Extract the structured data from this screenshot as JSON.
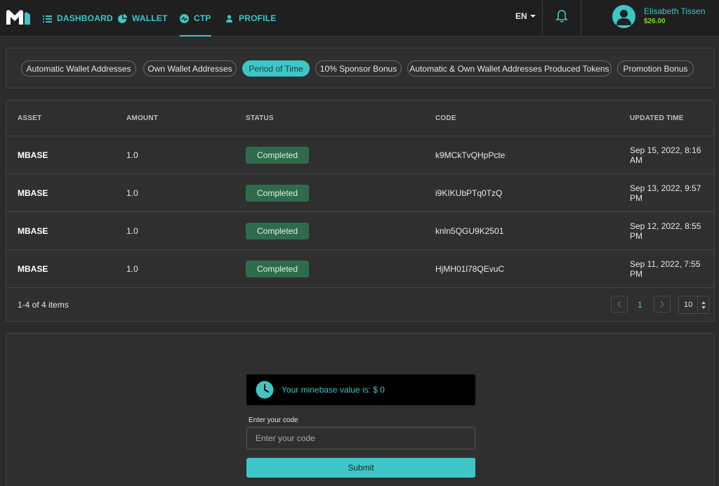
{
  "brand": {
    "logo_icon": "minebase-m-logo",
    "accent": "#3ec6c6"
  },
  "nav": {
    "items": [
      {
        "label": "DASHBOARD",
        "icon": "list-icon"
      },
      {
        "label": "WALLET",
        "icon": "pie-chart-icon"
      },
      {
        "label": "CTP",
        "icon": "activity-icon",
        "active": true
      },
      {
        "label": "PROFILE",
        "icon": "user-icon"
      }
    ],
    "language": "EN"
  },
  "user": {
    "name": "Elisabeth Tissen",
    "balance": "$26.00"
  },
  "filters": [
    {
      "label": "Automatic Wallet Addresses"
    },
    {
      "label": "Own Wallet Addresses"
    },
    {
      "label": "Period of Time",
      "active": true
    },
    {
      "label": "10% Sponsor Bonus"
    },
    {
      "label": "Automatic & Own Wallet Addresses Produced Tokens"
    },
    {
      "label": "Promotion Bonus"
    }
  ],
  "table": {
    "headers": [
      "ASSET",
      "AMOUNT",
      "STATUS",
      "CODE",
      "UPDATED TIME"
    ],
    "rows": [
      {
        "asset": "MBASE",
        "amount": "1.0",
        "status": "Completed",
        "code": "k9MCkTvQHpPcte",
        "updated": "Sep 15, 2022, 8:16 AM"
      },
      {
        "asset": "MBASE",
        "amount": "1.0",
        "status": "Completed",
        "code": "i9KIKUbPTq0TzQ",
        "updated": "Sep 13, 2022, 9:57 PM"
      },
      {
        "asset": "MBASE",
        "amount": "1.0",
        "status": "Completed",
        "code": "knln5QGU9K2501",
        "updated": "Sep 12, 2022, 8:55 PM"
      },
      {
        "asset": "MBASE",
        "amount": "1.0",
        "status": "Completed",
        "code": "HjMH01l78QEvuC",
        "updated": "Sep 11, 2022, 7:55 PM"
      }
    ],
    "items_count": "1-4 of 4 items",
    "current_page": "1",
    "page_size": "10",
    "status_color": "#2e6b4c"
  },
  "form": {
    "value_text": "Your minebase value is: $ 0",
    "input_label": "Enter your code",
    "input_placeholder": "Enter your code",
    "input_value": "",
    "submit_label": "Submit"
  }
}
